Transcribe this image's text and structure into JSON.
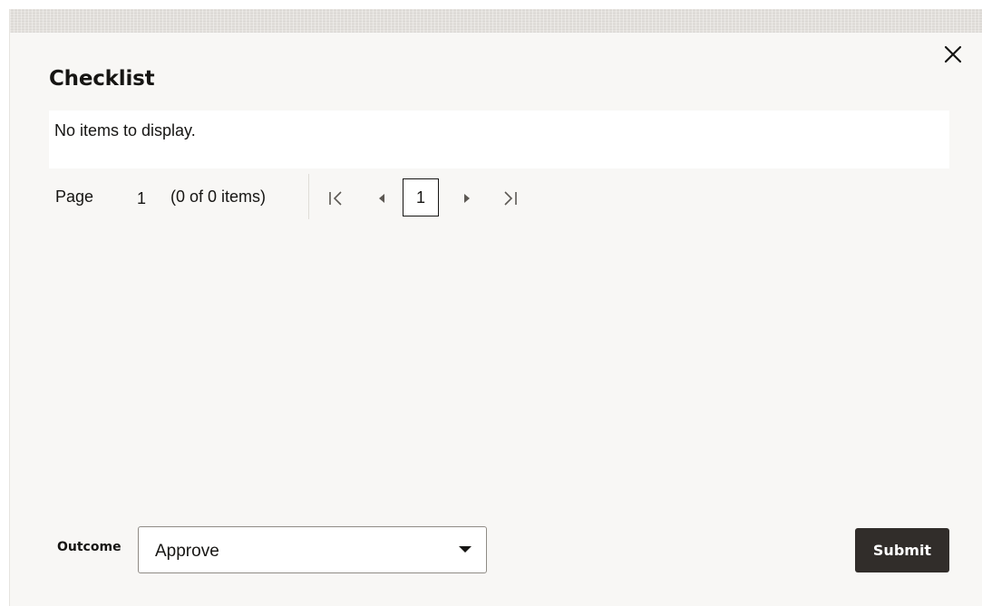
{
  "dialog": {
    "title": "Checklist",
    "close_icon": "close-icon"
  },
  "table": {
    "empty_message": "No items to display."
  },
  "pagination": {
    "label": "Page",
    "current_page": "1",
    "item_count": "(0 of 0 items)",
    "page_button": "1",
    "icons": [
      "first-page-icon",
      "previous-page-icon",
      "next-page-icon",
      "last-page-icon"
    ]
  },
  "footer": {
    "outcome_label": "Outcome",
    "outcome_value": "Approve",
    "submit_label": "Submit"
  },
  "colors": {
    "dialog_background": "#f8f7f5",
    "submit_background": "#312d2a",
    "text": "#161513"
  }
}
